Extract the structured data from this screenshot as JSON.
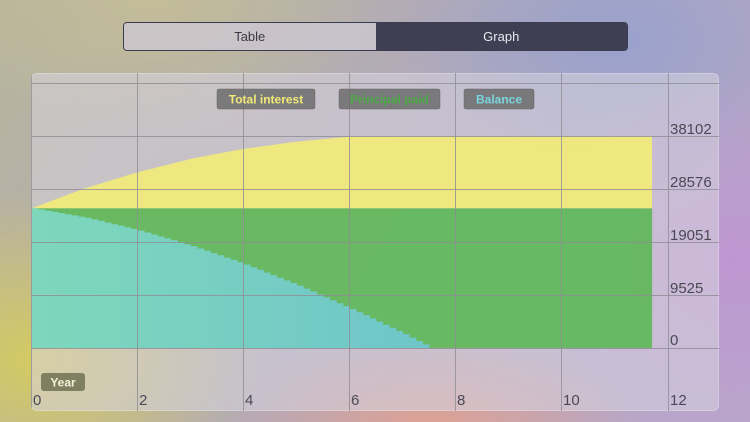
{
  "tabs": {
    "table_label": "Table",
    "graph_label": "Graph",
    "active": "Graph"
  },
  "colors": {
    "interest": "#f2ea78",
    "principal": "#5db857",
    "balance": "#7fd9c0",
    "grid": "#8f8d95",
    "legend_bg": "#6a6a6a"
  },
  "chart_data": {
    "type": "area",
    "xlabel": "Year",
    "x_ticks": [
      "0",
      "2",
      "4",
      "6",
      "8",
      "10",
      "12"
    ],
    "y_ticks": [
      "0",
      "9525",
      "19051",
      "28576",
      "38102"
    ],
    "xlim": [
      0,
      12
    ],
    "ylim": [
      0,
      38102
    ],
    "legend": [
      {
        "label": "Total interest",
        "color": "#f2ea78"
      },
      {
        "label": "Principal paid",
        "color": "#4caa46"
      },
      {
        "label": "Balance",
        "color": "#7ad6dc"
      }
    ],
    "stacked_total": {
      "x": [
        0,
        1,
        2,
        3,
        4,
        5,
        6,
        7,
        7.5,
        10,
        11.7
      ],
      "y": [
        25100,
        28700,
        31600,
        34000,
        35800,
        37100,
        38000,
        38102,
        38102,
        38102,
        38102
      ]
    },
    "principal_plus_balance": 25100,
    "balance": {
      "x": [
        0,
        1,
        2,
        3,
        4,
        5,
        6,
        7,
        7.5
      ],
      "y": [
        25100,
        23400,
        21100,
        18300,
        15000,
        11200,
        7000,
        2500,
        0
      ]
    }
  }
}
